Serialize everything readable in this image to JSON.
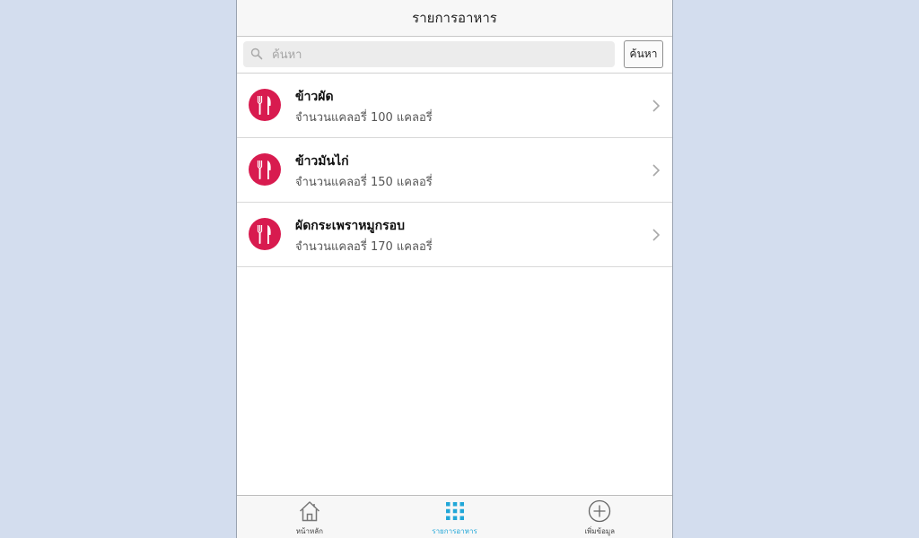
{
  "header": {
    "title": "รายการอาหาร"
  },
  "search": {
    "placeholder": "ค้นหา",
    "value": "",
    "button_label": "ค้นหา",
    "icon": "search-icon"
  },
  "foods": [
    {
      "name": "ข้าวผัด",
      "calories_text": "จำนวนแคลอรี่ 100 แคลอรี่",
      "icon": "fork-knife-icon"
    },
    {
      "name": "ข้าวมันไก่",
      "calories_text": "จำนวนแคลอรี่ 150 แคลอรี่",
      "icon": "fork-knife-icon"
    },
    {
      "name": "ผัดกระเพราหมูกรอบ",
      "calories_text": "จำนวนแคลอรี่ 170 แคลอรี่",
      "icon": "fork-knife-icon"
    }
  ],
  "tabbar": {
    "tabs": [
      {
        "label": "หน้าหลัก",
        "icon": "home-icon",
        "active": false
      },
      {
        "label": "รายการอาหาร",
        "icon": "grid-icon",
        "active": true
      },
      {
        "label": "เพิ่มข้อมูล",
        "icon": "add-circle-icon",
        "active": false
      }
    ]
  },
  "colors": {
    "accent": "#22a7d8",
    "food_icon_bg": "#d81b4f",
    "page_bg": "#d3ddee"
  }
}
